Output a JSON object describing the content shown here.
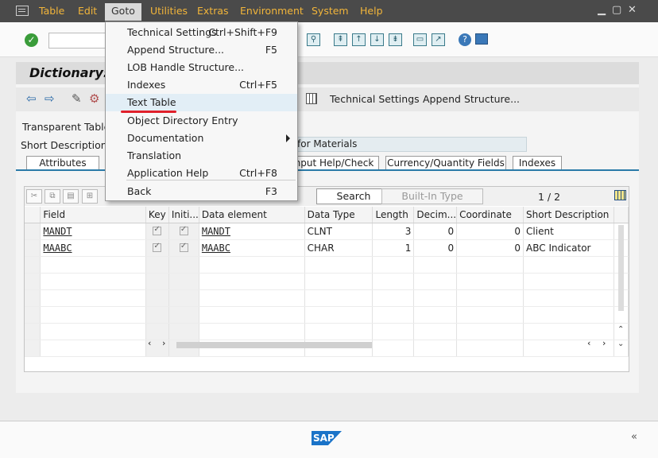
{
  "menubar": {
    "items": [
      "Table",
      "Edit",
      "Goto",
      "Utilities",
      "Extras",
      "Environment",
      "System",
      "Help"
    ],
    "active": "Goto"
  },
  "title": "Dictionary:",
  "toolbar2": {
    "technical_settings": "Technical Settings",
    "append_structure": "Append Structure..."
  },
  "attributes": {
    "table_type_label": "Transparent Table",
    "short_description_label": "Short Description",
    "short_description_value": "for Materials"
  },
  "tabs": [
    "Attributes",
    "nput Help/Check",
    "Currency/Quantity Fields",
    "Indexes"
  ],
  "grid": {
    "search_label": "Search",
    "builtin_type_label": "Built-In Type",
    "pager": "1  /  2",
    "columns": [
      "Field",
      "Key",
      "Initi...",
      "Data element",
      "Data Type",
      "Length",
      "Decim...",
      "Coordinate",
      "Short Description"
    ],
    "rows": [
      {
        "field": "MANDT",
        "data_element": "MANDT",
        "data_type": "CLNT",
        "length": "3",
        "decimals": "0",
        "coordinate": "0",
        "description": "Client"
      },
      {
        "field": "MAABC",
        "data_element": "MAABC",
        "data_type": "CHAR",
        "length": "1",
        "decimals": "0",
        "coordinate": "0",
        "description": "ABC Indicator"
      }
    ]
  },
  "dropdown": {
    "items": [
      {
        "label": "Technical Settings",
        "shortcut": "Ctrl+Shift+F9"
      },
      {
        "label": "Append Structure...",
        "shortcut": "F5"
      },
      {
        "label": "LOB Handle Structure...",
        "shortcut": ""
      },
      {
        "label": "Indexes",
        "shortcut": "Ctrl+F5"
      },
      {
        "label": "Text Table",
        "shortcut": ""
      },
      {
        "label": "Object Directory Entry",
        "shortcut": ""
      },
      {
        "label": "Documentation",
        "shortcut": ""
      },
      {
        "label": "Translation",
        "shortcut": ""
      },
      {
        "label": "Application Help",
        "shortcut": "Ctrl+F8"
      },
      {
        "label": "Back",
        "shortcut": "F3"
      }
    ],
    "highlighted": "Text Table"
  },
  "footer": {
    "logo": "SAP",
    "collapse": "«"
  },
  "colors": {
    "menubar": "#4a4a4a",
    "menu_text": "#f2b53a",
    "accent": "#2a7aa8",
    "highlight_underline": "#e0202a"
  }
}
